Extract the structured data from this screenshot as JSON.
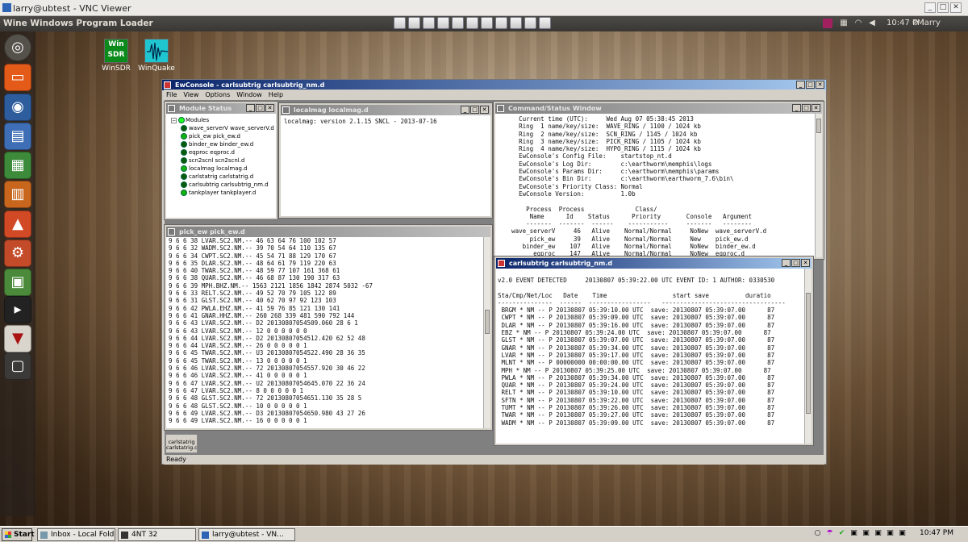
{
  "vnc": {
    "title": "larry@ubtest - VNC Viewer"
  },
  "ubuntu": {
    "app_title": "Wine Windows Program Loader",
    "time": "10:47 PM",
    "user": "larry"
  },
  "desktop": [
    {
      "label": "WinSDR",
      "icon_text": "Win SDR"
    },
    {
      "label": "WinQuake"
    }
  ],
  "ewconsole": {
    "title": "EwConsole - carlsubtrig carlsubtrig_nm.d",
    "menu": [
      "File",
      "View",
      "Options",
      "Window",
      "Help"
    ],
    "status": "Ready",
    "minimized_label": "carlstatrig carlstatrig.d"
  },
  "module_status": {
    "title": "Module Status",
    "root": "Modules",
    "items": [
      "wave_serverV wave_serverV.d",
      "pick_ew pick_ew.d",
      "binder_ew binder_ew.d",
      "eqproc eqproc.d",
      "scn2scnl scn2scnl.d",
      "localmag localmag.d",
      "carlstatrig carlstatrig.d",
      "carlsubtrig carlsubtrig_nm.d",
      "tankplayer tankplayer.d"
    ]
  },
  "localmag": {
    "title": "localmag localmag.d",
    "text": "localmag: version 2.1.15 SNCL - 2013-07-16"
  },
  "command": {
    "title": "Command/Status Window",
    "text": "      Current time (UTC):     Wed Aug 07 05:38:45 2013\n      Ring  1 name/key/size:  WAVE_RING / 1100 / 1024 kb\n      Ring  2 name/key/size:  SCN_RING / 1145 / 1024 kb\n      Ring  3 name/key/size:  PICK_RING / 1105 / 1024 kb\n      Ring  4 name/key/size:  HYPO_RING / 1115 / 1024 kb\n      EwConsole's Config File:    startstop_nt.d\n      EwConsole's Log Dir:        c:\\earthworm\\memphis\\logs\n      EwConsole's Params Dir:     c:\\earthworm\\memphis\\params\n      EwConsole's Bin Dir:        c:\\earthworm\\earthworm_7.6\\bin\\\n      EwConsole's Priority Class: Normal\n      EwConsole Version:          1.0b\n\n        Process  Process              Class/\n         Name      Id    Status      Priority       Console   Argument\n        -------  -------  ------    -----------     -------   --------\n    wave_serverV     46   Alive    Normal/Normal     NoNew  wave_serverV.d\n         pick_ew     39   Alive    Normal/Normal     New    pick_ew.d\n       binder_ew    107   Alive    Normal/Normal     NoNew  binder_ew.d\n          eqproc    147   Alive    Normal/Normal     NoNew  eqproc.d"
  },
  "pick_ew": {
    "title": "pick_ew pick_ew.d",
    "text": "9 6 6 38 LVAR.SC2.NM.-- 46 63 64 76 100 102 57\n9 6 6 32 WADM.SC2.NM.-- 39 70 54 64 110 135 67\n9 6 6 34 CWPT.SC2.NM.-- 45 54 71 88 129 170 67\n9 6 6 35 DLAR.SC2.NM.-- 48 64 61 79 119 220 63\n9 6 6 40 TWAR.SC2.NM.-- 48 59 77 107 161 368 61\n9 6 6 38 QUAR.SC2.NM.-- 46 68 87 130 190 317 63\n9 6 6 39 MPH.BHZ.NM.-- 1563 2121 1856 1842 2874 5032 -67\n9 6 6 33 RELT.SC2.NM.-- 49 52 70 79 105 122 89\n9 6 6 31 GLST.SC2.NM.-- 40 62 70 97 92 123 103\n9 6 6 42 PWLA.EHZ.NM.-- 41 59 76 85 121 130 141\n9 6 6 41 GNAR.HHZ.NM.-- 260 268 339 481 590 792 144\n9 6 6 43 LVAR.SC2.NM.-- D2 20130807054509.060 28 6 1\n9 6 6 43 LVAR.SC2.NM.-- 12 0 0 0 0 0 0\n9 6 6 44 LVAR.SC2.NM.-- D2 20130807054512.420 62 52 48\n9 6 6 44 LVAR.SC2.NM.-- 26 0 0 0 0 0 1\n9 6 6 45 TWAR.SC2.NM.-- U3 20130807054522.490 28 36 35\n9 6 6 45 TWAR.SC2.NM.-- 13 0 0 0 0 0 1\n9 6 6 46 LVAR.SC2.NM.-- 72 20130807054557.920 30 46 22\n9 6 6 46 LVAR.SC2.NM.-- 41 0 0 0 0 0 1\n9 6 6 47 LVAR.SC2.NM.-- U2 20130807054645.070 22 36 24\n9 6 6 47 LVAR.SC2.NM.-- 8 0 0 0 0 0 1\n9 6 6 48 GLST.SC2.NM.-- 72 20130807054651.130 35 28 5\n9 6 6 48 GLST.SC2.NM.-- 10 0 0 0 0 0 1\n9 6 6 49 LVAR.SC2.NM.-- D3 20130807054650.980 43 27 26\n9 6 6 49 LVAR.SC2.NM.-- 16 0 0 0 0 0 1"
  },
  "carlsubtrig": {
    "title": "carlsubtrig carlsubtrig_nm.d",
    "text": "v2.0 EVENT DETECTED     20130807 05:39:22.00 UTC EVENT ID: 1 AUTHOR: 0330530\n\nSta/Cmp/Net/Loc   Date    Time                  start save          duratio\n---------------  ------  -----------------   ----------------------------------\n BRGM * NM -- P 20130807 05:39:10.00 UTC  save: 20130807 05:39:07.00      87\n CWPT * NM -- P 20130807 05:39:09.00 UTC  save: 20130807 05:39:07.00      87\n DLAR * NM -- P 20130807 05:39:16.00 UTC  save: 20130807 05:39:07.00      87\n EBZ * NM -- P 20130807 05:39:24.00 UTC  save: 20130807 05:39:07.00      87\n GLST * NM -- P 20130807 05:39:07.00 UTC  save: 20130807 05:39:07.00      87\n GNAR * NM -- P 20130807 05:39:34.00 UTC  save: 20130807 05:39:07.00      87\n LVAR * NM -- P 20130807 05:39:17.00 UTC  save: 20130807 05:39:07.00      87\n MLNT * NM -- P 00000000 00:00:00.00 UTC  save: 20130807 05:39:07.00      87\n MPH * NM -- P 20130807 05:39:25.00 UTC  save: 20130807 05:39:07.00      87\n PWLA * NM -- P 20130807 05:39:34.00 UTC  save: 20130807 05:39:07.00      87\n QUAR * NM -- P 20130807 05:39:24.00 UTC  save: 20130807 05:39:07.00      87\n RELT * NM -- P 20130807 05:39:10.00 UTC  save: 20130807 05:39:07.00      87\n SFTN * NM -- P 20130807 05:39:22.00 UTC  save: 20130807 05:39:07.00      87\n TUMT * NM -- P 20130807 05:39:26.00 UTC  save: 20130807 05:39:07.00      87\n TWAR * NM -- P 20130807 05:39:27.00 UTC  save: 20130807 05:39:07.00      87\n WADM * NM -- P 20130807 05:39:09.00 UTC  save: 20130807 05:39:07.00      87"
  },
  "taskbar": {
    "start": "Start",
    "buttons": [
      "Inbox - Local Folde...",
      "4NT 32",
      "larry@ubtest - VN..."
    ],
    "time": "10:47 PM"
  }
}
